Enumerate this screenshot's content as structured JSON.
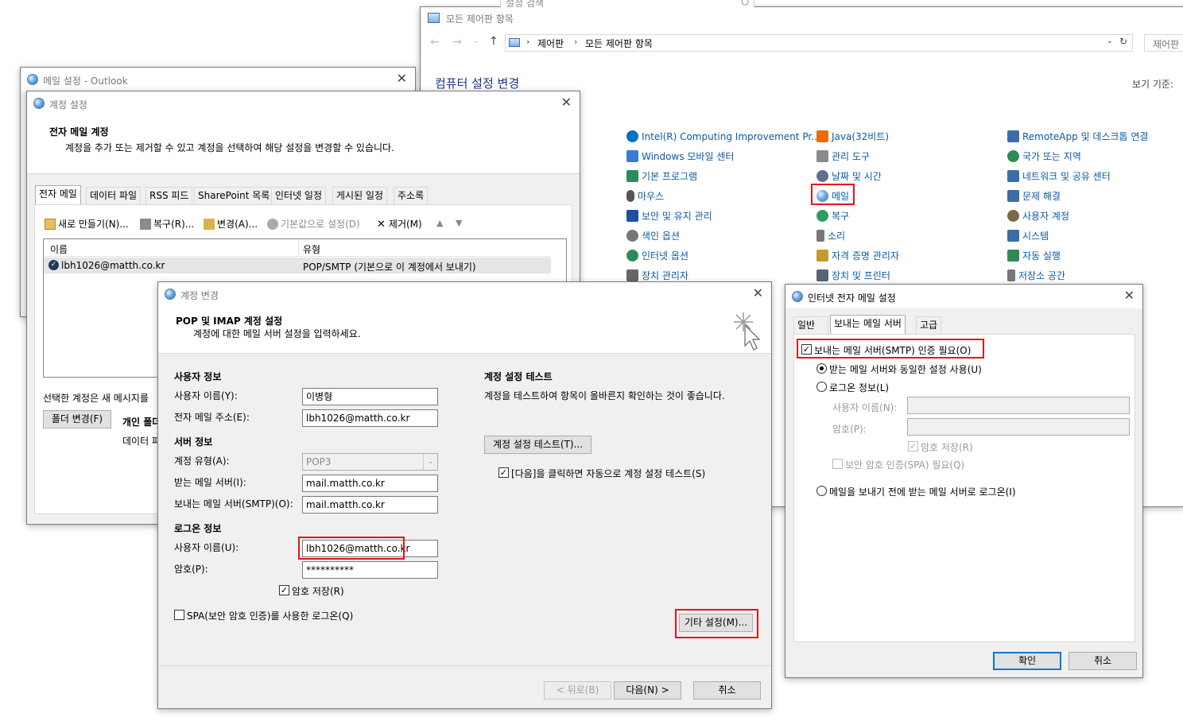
{
  "control_panel": {
    "window_title": "모든 제어판 항목",
    "breadcrumb": [
      "제어판",
      "모든 제어판 항목"
    ],
    "search_placeholder": "제어판",
    "top_search_partial": "설정 검색",
    "heading": "컴퓨터 설정 변경",
    "view_by": "보기 기준:",
    "items": [
      {
        "label": "Intel(R) Computing Improvement Pr...",
        "icon": "intel-icon",
        "color": "#0071c5"
      },
      {
        "label": "Windows 모바일 센터",
        "icon": "mobility-center-icon",
        "color": "#3a7bd5"
      },
      {
        "label": "기본 프로그램",
        "icon": "default-programs-icon",
        "color": "#2e8b57"
      },
      {
        "label": "마우스",
        "icon": "mouse-icon",
        "color": "#555555"
      },
      {
        "label": "보안 및 유지 관리",
        "icon": "flag-icon",
        "color": "#1e50a2"
      },
      {
        "label": "색인 옵션",
        "icon": "indexing-icon",
        "color": "#777777"
      },
      {
        "label": "인터넷 옵션",
        "icon": "internet-options-icon",
        "color": "#2e8b57"
      },
      {
        "label": "장치 관리자",
        "icon": "device-manager-icon",
        "color": "#666666"
      },
      {
        "label": "Java(32비트)",
        "icon": "java-icon",
        "color": "#e76f00"
      },
      {
        "label": "관리 도구",
        "icon": "admin-tools-icon",
        "color": "#8a8a8a"
      },
      {
        "label": "날짜 및 시간",
        "icon": "clock-icon",
        "color": "#5f6f8f"
      },
      {
        "label": "메일",
        "icon": "mail-icon",
        "color": "#3b82c4"
      },
      {
        "label": "복구",
        "icon": "recovery-icon",
        "color": "#2e9e5e"
      },
      {
        "label": "소리",
        "icon": "speaker-icon",
        "color": "#777777"
      },
      {
        "label": "자격 증명 관리자",
        "icon": "credential-icon",
        "color": "#c49a2c"
      },
      {
        "label": "장치 및 프린터",
        "icon": "printer-icon",
        "color": "#556677"
      },
      {
        "label": "RemoteApp 및 데스크톱 연결",
        "icon": "remoteapp-icon",
        "color": "#3a6ea5"
      },
      {
        "label": "국가 또는 지역",
        "icon": "globe-icon",
        "color": "#2e8b57"
      },
      {
        "label": "네트워크 및 공유 센터",
        "icon": "network-icon",
        "color": "#3a6ea5"
      },
      {
        "label": "문제 해결",
        "icon": "troubleshoot-icon",
        "color": "#3a6ea5"
      },
      {
        "label": "사용자 계정",
        "icon": "users-icon",
        "color": "#7a6a4a"
      },
      {
        "label": "시스템",
        "icon": "system-icon",
        "color": "#3a6ea5"
      },
      {
        "label": "자동 실행",
        "icon": "autoplay-icon",
        "color": "#2e8b57"
      },
      {
        "label": "저장소 공간",
        "icon": "storage-icon",
        "color": "#777777"
      }
    ]
  },
  "mail_setup": {
    "title": "메일 설정 - Outlook"
  },
  "account_settings": {
    "title": "계정 설정",
    "header_title": "전자 메일 계정",
    "header_desc": "계정을 추가 또는 제거할 수 있고 계정을 선택하여 해당 설정을 변경할 수 있습니다.",
    "tabs": [
      "전자 메일",
      "데이터 파일",
      "RSS 피드",
      "SharePoint 목록",
      "인터넷 일정",
      "게시된 일정",
      "주소록"
    ],
    "toolbar": {
      "new": "새로 만들기(N)...",
      "repair": "복구(R)...",
      "change": "변경(A)...",
      "default": "기본값으로 설정(D)",
      "remove": "제거(M)"
    },
    "columns": [
      "이름",
      "유형"
    ],
    "row": {
      "name": "lbh1026@matth.co.kr",
      "type": "POP/SMTP (기본으로 이 계정에서 보내기)"
    },
    "bottom_text": "선택한 계정은 새 메시지를",
    "folder_button": "폴더 변경(F)",
    "personal_folder": "개인 폴더",
    "data_file": "데이터 파"
  },
  "change_account": {
    "title": "계정 변경",
    "header_title": "POP 및 IMAP 계정 설정",
    "header_desc": "계정에 대한 메일 서버 설정을 입력하세요.",
    "user_info_heading": "사용자 정보",
    "user_name_label": "사용자 이름(Y):",
    "user_name_value": "이병형",
    "email_label": "전자 메일 주소(E):",
    "email_value": "lbh1026@matth.co.kr",
    "server_info_heading": "서버 정보",
    "account_type_label": "계정 유형(A):",
    "account_type_value": "POP3",
    "incoming_label": "받는 메일 서버(I):",
    "incoming_value": "mail.matth.co.kr",
    "outgoing_label": "보내는 메일 서버(SMTP)(O):",
    "outgoing_value": "mail.matth.co.kr",
    "logon_heading": "로그온 정보",
    "logon_user_label": "사용자 이름(U):",
    "logon_user_value": "lbh1026@matth.co.kr",
    "password_label": "암호(P):",
    "password_value": "**********",
    "save_password_label": "암호 저장(R)",
    "spa_label": "SPA(보안 암호 인증)를 사용한 로그온(Q)",
    "test_heading": "계정 설정 테스트",
    "test_desc": "계정을 테스트하여 항목이 올바른지 확인하는 것이 좋습니다.",
    "test_button": "계정 설정 테스트(T)...",
    "auto_test_label": "[다음]을 클릭하면 자동으로 계정 설정 테스트(S)",
    "more_settings_button": "기타 설정(M)...",
    "back_button": "< 뒤로(B)",
    "next_button": "다음(N) >",
    "cancel_button": "취소"
  },
  "internet_email": {
    "title": "인터넷 전자 메일 설정",
    "tabs": [
      "일반",
      "보내는 메일 서버",
      "고급"
    ],
    "smtp_auth_label": "보내는 메일 서버(SMTP) 인증 필요(O)",
    "same_settings_label": "받는 메일 서버와 동일한 설정 사용(U)",
    "logon_with_label": "로그온 정보(L)",
    "user_name_label": "사용자 이름(N):",
    "password_label": "암호(P):",
    "save_password_label": "암호 저장(R)",
    "spa_label": "보안 암호 인증(SPA) 필요(Q)",
    "logon_before_label": "메일을 보내기 전에 받는 메일 서버로 로그온(I)",
    "ok_button": "확인",
    "cancel_button": "취소"
  }
}
